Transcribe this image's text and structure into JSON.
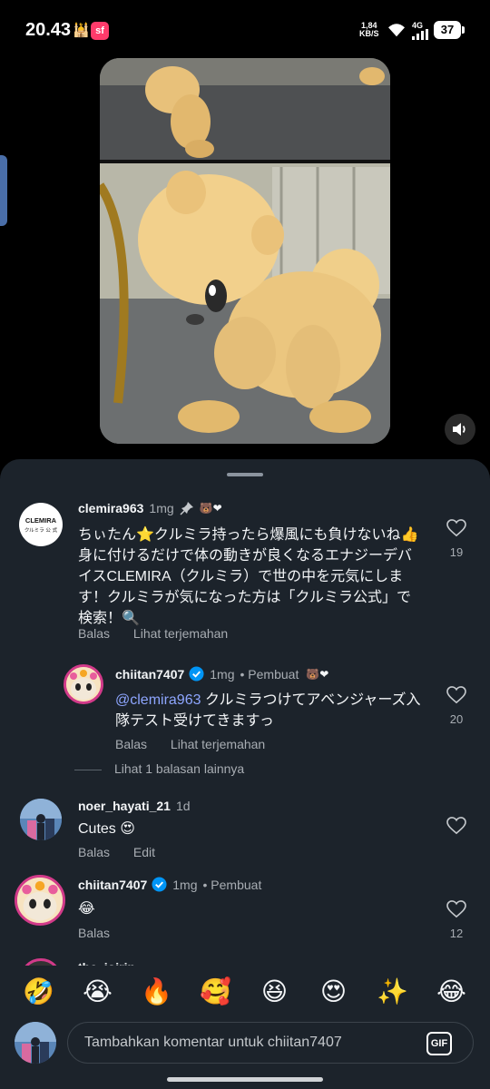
{
  "status_bar": {
    "time": "20.43",
    "app_badge": "sf",
    "net_speed_value": "1,84",
    "net_speed_unit": "KB/S",
    "network": "4G",
    "battery": "37"
  },
  "comments": [
    {
      "username": "clemira963",
      "time": "1mg",
      "text": "ちぃたん⭐️クルミラ持ったら爆風にも負けないね👍身に付けるだけで体の動きが良くなるエナジーデバイスCLEMIRA（クルミラ）で世の中を元気にします！クルミラが気になった方は「クルミラ公式」で検索！🔍",
      "avatar_text_top": "CLEMIRA",
      "avatar_text_bottom": "クルミラ 公 式",
      "actions": [
        "Balas",
        "Lihat terjemahan"
      ],
      "likes": "19"
    },
    {
      "username": "chiitan7407",
      "time": "1mg",
      "creator_label": "Pembuat",
      "mention": "@clemira963",
      "text": " クルミラつけてアベンジャーズ入隊テスト受けてきますっ",
      "actions": [
        "Balas",
        "Lihat terjemahan"
      ],
      "likes": "20"
    },
    {
      "username": "noer_hayati_21",
      "time": "1d",
      "text": "Cutes 😍",
      "actions": [
        "Balas",
        "Edit"
      ],
      "likes": ""
    },
    {
      "username": "chiitan7407",
      "time": "1mg",
      "creator_label": "Pembuat",
      "text": "😂",
      "actions": [
        "Balas"
      ],
      "likes": "12"
    }
  ],
  "more_replies": "Lihat 1 balasan lainnya",
  "partial_username": "the_joirin",
  "emoji_bar": [
    "🤣",
    "😭",
    "🔥",
    "🥰",
    "😆",
    "😍",
    "✨",
    "😂"
  ],
  "input": {
    "placeholder": "Tambahkan komentar untuk chiitan7407",
    "gif_label": "GIF"
  },
  "colors": {
    "sheet_bg": "#1c232b",
    "verified": "#0095f6",
    "mention": "#8ea6ff"
  }
}
